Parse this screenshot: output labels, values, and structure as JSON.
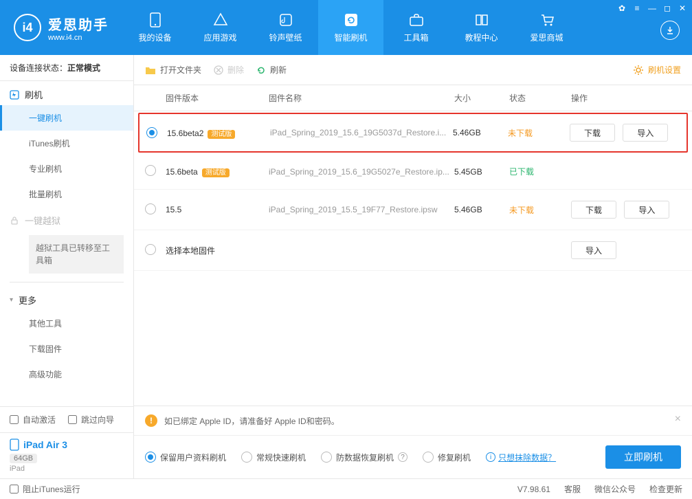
{
  "header": {
    "logo_main": "爱思助手",
    "logo_sub": "www.i4.cn",
    "nav": [
      {
        "label": "我的设备"
      },
      {
        "label": "应用游戏"
      },
      {
        "label": "铃声壁纸"
      },
      {
        "label": "智能刷机"
      },
      {
        "label": "工具箱"
      },
      {
        "label": "教程中心"
      },
      {
        "label": "爱思商城"
      }
    ]
  },
  "sidebar": {
    "status_label": "设备连接状态：",
    "status_value": "正常模式",
    "section_flash": "刷机",
    "items_flash": [
      "一键刷机",
      "iTunes刷机",
      "专业刷机",
      "批量刷机"
    ],
    "section_jailbreak": "一键越狱",
    "jailbreak_note": "越狱工具已转移至工具箱",
    "section_more": "更多",
    "items_more": [
      "其他工具",
      "下载固件",
      "高级功能"
    ],
    "auto_activate": "自动激活",
    "skip_guide": "跳过向导",
    "device_name": "iPad Air 3",
    "device_capacity": "64GB",
    "device_type": "iPad"
  },
  "toolbar": {
    "open_folder": "打开文件夹",
    "delete": "删除",
    "refresh": "刷新",
    "settings": "刷机设置"
  },
  "table": {
    "headers": {
      "version": "固件版本",
      "name": "固件名称",
      "size": "大小",
      "status": "状态",
      "action": "操作"
    },
    "rows": [
      {
        "selected": true,
        "version": "15.6beta2",
        "beta": "测试版",
        "name": "iPad_Spring_2019_15.6_19G5037d_Restore.i...",
        "size": "5.46GB",
        "status": "未下载",
        "status_class": "not",
        "download": "下载",
        "import": "导入",
        "highlighted": true
      },
      {
        "selected": false,
        "version": "15.6beta",
        "beta": "测试版",
        "name": "iPad_Spring_2019_15.6_19G5027e_Restore.ip...",
        "size": "5.45GB",
        "status": "已下载",
        "status_class": "done"
      },
      {
        "selected": false,
        "version": "15.5",
        "beta": "",
        "name": "iPad_Spring_2019_15.5_19F77_Restore.ipsw",
        "size": "5.46GB",
        "status": "未下载",
        "status_class": "not",
        "download": "下载",
        "import": "导入"
      },
      {
        "selected": false,
        "version": "选择本地固件",
        "beta": "",
        "name": "",
        "size": "",
        "status": "",
        "import": "导入"
      }
    ]
  },
  "bottom": {
    "warning": "如已绑定 Apple ID，请准备好 Apple ID和密码。",
    "options": [
      "保留用户资料刷机",
      "常规快速刷机",
      "防数据恢复刷机",
      "修复刷机"
    ],
    "erase_link": "只想抹除数据？",
    "flash_btn": "立即刷机"
  },
  "footer": {
    "block_itunes": "阻止iTunes运行",
    "version": "V7.98.61",
    "service": "客服",
    "wechat": "微信公众号",
    "update": "检查更新"
  }
}
